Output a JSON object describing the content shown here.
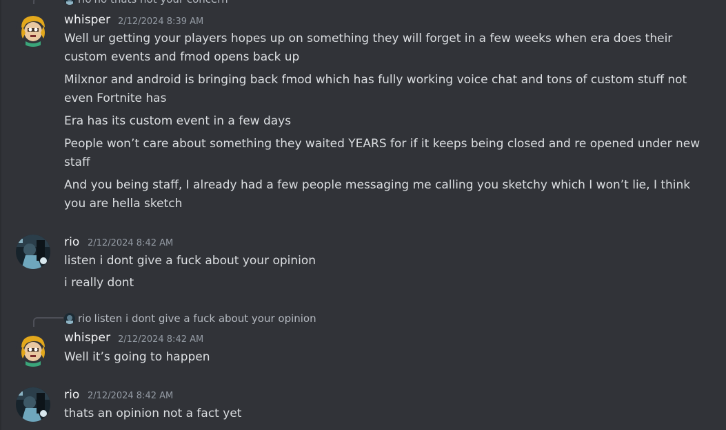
{
  "top_reply": {
    "author": "rio",
    "text": "no thats not your concern"
  },
  "groups": [
    {
      "author": "whisper",
      "timestamp": "2/12/2024 8:39 AM",
      "lines": [
        "Well ur getting your players hopes up on something they will forget in a few weeks when era does their custom events and fmod opens back up",
        "Milxnor and android is bringing back fmod which has fully working voice chat and tons of custom stuff not even Fortnite has",
        "Era has its custom event in a few days",
        "People won’t care about something they waited YEARS for if it keeps being closed and re opened under new staff",
        "And you being staff, I already had a few people messaging me calling you sketchy which I won’t lie, I think you are hella sketch"
      ]
    },
    {
      "author": "rio",
      "timestamp": "2/12/2024 8:42 AM",
      "lines": [
        "listen i dont give a fuck about your opinion",
        "i really dont"
      ]
    },
    {
      "author": "whisper",
      "timestamp": "2/12/2024 8:42 AM",
      "reply": {
        "author": "rio",
        "text": "listen i dont give a fuck about your opinion"
      },
      "lines": [
        "Well it’s going to happen"
      ]
    },
    {
      "author": "rio",
      "timestamp": "2/12/2024 8:42 AM",
      "lines": [
        "thats an opinion not a fact yet"
      ]
    }
  ],
  "colors": {
    "background": "#313338",
    "text": "#dbdee1",
    "username": "#f2f3f5",
    "timestamp": "#949ba4"
  }
}
